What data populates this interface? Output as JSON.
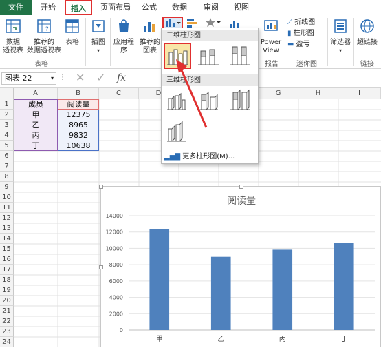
{
  "tabs": [
    "文件",
    "开始",
    "插入",
    "页面布局",
    "公式",
    "数据",
    "审阅",
    "视图"
  ],
  "ribbon": {
    "pivot_label_1": "数据",
    "pivot_label_2": "透视表",
    "rec_pivot_label_1": "推荐的",
    "rec_pivot_label_2": "数据透视表",
    "table_label": "表格",
    "illus_label": "插图",
    "apps_label_1": "应用程",
    "apps_label_2": "序",
    "rec_chart_label_1": "推荐的",
    "rec_chart_label_2": "图表",
    "powerview_1": "Power",
    "powerview_2": "View",
    "sparkline_line": "折线图",
    "sparkline_col": "柱形图",
    "sparkline_wl": "盈亏",
    "filter_label": "筛选器",
    "hyperlink_label": "超链接",
    "group_tables": "表格",
    "group_report": "报告",
    "group_sparklines": "迷你图",
    "group_links": "链接"
  },
  "formula_bar": {
    "name_box": "图表 22",
    "fx": "fx"
  },
  "columns": [
    "A",
    "B",
    "C",
    "D",
    "E",
    "F",
    "G",
    "H",
    "I"
  ],
  "rows": [
    "1",
    "2",
    "3",
    "4",
    "5",
    "6",
    "7",
    "8",
    "9",
    "10",
    "11",
    "12",
    "13",
    "14",
    "15",
    "16",
    "17",
    "18",
    "19",
    "20",
    "21",
    "22",
    "23",
    "24"
  ],
  "table": {
    "header": [
      "成员",
      "阅读量"
    ],
    "data": [
      [
        "甲",
        "12375"
      ],
      [
        "乙",
        "8965"
      ],
      [
        "丙",
        "9832"
      ],
      [
        "丁",
        "10638"
      ]
    ]
  },
  "dropdown": {
    "section_2d": "二维柱形图",
    "section_3d": "三维柱形图",
    "more_link": "更多柱形图(M)..."
  },
  "chart_data": {
    "type": "bar",
    "title": "阅读量",
    "categories": [
      "甲",
      "乙",
      "丙",
      "丁"
    ],
    "values": [
      12375,
      8965,
      9832,
      10638
    ],
    "ylim": [
      0,
      14000
    ],
    "yticks": [
      "0",
      "2000",
      "4000",
      "6000",
      "8000",
      "10000",
      "12000",
      "14000"
    ],
    "grid": true,
    "bar_color": "#4f81bd"
  },
  "colors": {
    "accent": "#217346",
    "highlight": "#e03030",
    "bar": "#4f81bd"
  }
}
